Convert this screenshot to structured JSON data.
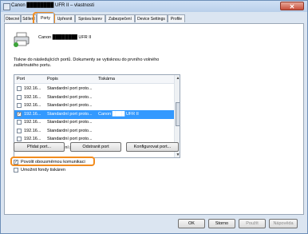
{
  "window": {
    "title": "Canon ████████ UFR II – vlastnosti",
    "close_label": "✕"
  },
  "tabs": [
    {
      "label": "Obecné"
    },
    {
      "label": "Sdílení"
    },
    {
      "label": "Porty",
      "active": true
    },
    {
      "label": "Upřesnit"
    },
    {
      "label": "Správa barev"
    },
    {
      "label": "Zabezpečení"
    },
    {
      "label": "Device Settings"
    },
    {
      "label": "Profile"
    }
  ],
  "printer": {
    "name": "Canon ████████ UFR II",
    "icon": "printer-icon"
  },
  "description": "Tiskne do následujících portů. Dokumenty se vytisknou do prvního volného zaškrtnutého portu.",
  "ports_list": {
    "headers": [
      "Port",
      "Popis",
      "Tiskárna"
    ],
    "rows": [
      {
        "port": "192.16...",
        "desc": "Standardní port proto...",
        "printer": "",
        "checked": false,
        "selected": false
      },
      {
        "port": "192.16...",
        "desc": "Standardní port proto...",
        "printer": "",
        "checked": false,
        "selected": false
      },
      {
        "port": "192.16...",
        "desc": "Standardní port proto...",
        "printer": "",
        "checked": false,
        "selected": false
      },
      {
        "port": "192.16...",
        "desc": "Standardní port proto...",
        "printer": "Canon ████ UFR II",
        "checked": true,
        "selected": true
      },
      {
        "port": "192.16...",
        "desc": "Standardní port proto...",
        "printer": "",
        "checked": false,
        "selected": false
      },
      {
        "port": "192.16...",
        "desc": "Standardní port proto...",
        "printer": "",
        "checked": false,
        "selected": false
      },
      {
        "port": "192.16...",
        "desc": "Standardní port proto...",
        "printer": "",
        "checked": false,
        "selected": false
      },
      {
        "port": "192.16...",
        "desc": "Standardní port proto...",
        "printer": "",
        "checked": false,
        "selected": false
      }
    ]
  },
  "buttons": {
    "add_port": "Přidat port...",
    "delete_port": "Odstranit port",
    "configure_port": "Konfigurovat port...",
    "ok": "OK",
    "cancel": "Storno",
    "apply": "Použít",
    "help": "Nápověda"
  },
  "checks": {
    "bidirectional": {
      "label": "Povolit obousměrnou komunikaci",
      "checked": true
    },
    "pooling": {
      "label": "Umožnit fondy tiskáren",
      "checked": false
    }
  },
  "colors": {
    "highlight": "#f28c1e",
    "selection": "#3399ff"
  }
}
